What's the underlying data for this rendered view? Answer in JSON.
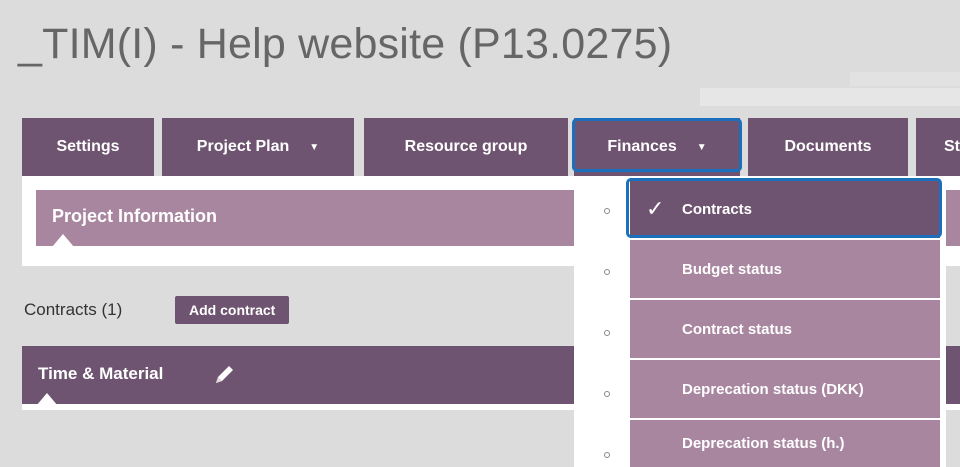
{
  "page_title": "_TIM(I) - Help website (P13.0275)",
  "tabs": [
    {
      "label": "Settings"
    },
    {
      "label": "Project Plan",
      "caret": "▼"
    },
    {
      "label": "Resource group"
    },
    {
      "label": "Finances",
      "caret": "▼"
    },
    {
      "label": "Documents"
    },
    {
      "label": "St"
    }
  ],
  "info_bar": {
    "label": "Project Information"
  },
  "contracts": {
    "heading": "Contracts (1)",
    "add_button": "Add contract",
    "item_label": "Time & Material"
  },
  "dropdown": {
    "items": [
      {
        "label": "Contracts",
        "active": true,
        "check": "✓"
      },
      {
        "label": "Budget status"
      },
      {
        "label": "Contract status"
      },
      {
        "label": "Deprecation status (DKK)"
      },
      {
        "label": "Deprecation status (h.)"
      }
    ]
  },
  "colors": {
    "accent": "#6e5470",
    "accent_light": "#a8869f",
    "highlight": "#1c6fbd",
    "background": "#dcdcdc"
  }
}
